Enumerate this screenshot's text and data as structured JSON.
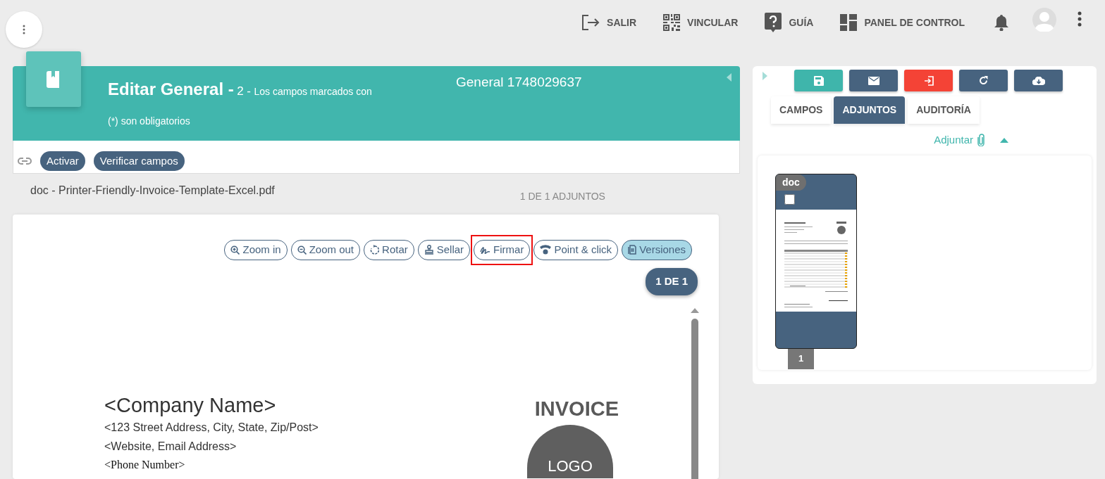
{
  "top_menu": [
    {
      "kind": "logout",
      "label": "SALIR"
    },
    {
      "kind": "qr",
      "label": "VINCULAR"
    },
    {
      "kind": "help",
      "label": "GUÍA"
    },
    {
      "kind": "dashboard",
      "label": "PANEL DE CONTROL"
    }
  ],
  "header": {
    "title": "Editar General -",
    "count": "2 -",
    "note": "Los campos marcados con (*) son obligatorios",
    "record": "General 1748029637"
  },
  "actions": [
    "Activar",
    "Verificar campos"
  ],
  "attachment": {
    "filename": "doc - Printer-Friendly-Invoice-Template-Excel.pdf",
    "counter": "1 DE 1 ADJUNTOS"
  },
  "viewer_tools": [
    {
      "kind": "zoom-in",
      "label": "Zoom in",
      "selected": false,
      "highlighted": false
    },
    {
      "kind": "zoom-out",
      "label": "Zoom out",
      "selected": false,
      "highlighted": false
    },
    {
      "kind": "rotate",
      "label": "Rotar",
      "selected": false,
      "highlighted": false
    },
    {
      "kind": "stamp",
      "label": "Sellar",
      "selected": false,
      "highlighted": false
    },
    {
      "kind": "sign",
      "label": "Firmar",
      "selected": false,
      "highlighted": true
    },
    {
      "kind": "pointer",
      "label": "Point & click",
      "selected": false,
      "highlighted": false
    },
    {
      "kind": "versions",
      "label": "Versiones",
      "selected": true,
      "highlighted": false
    }
  ],
  "page_indicator": "1 DE 1",
  "document": {
    "company": "<Company Name>",
    "address": "<123 Street Address, City, State, Zip/Post>",
    "web": "<Website, Email Address>",
    "phone": "<Phone Number>",
    "title": "INVOICE",
    "logo": "LOGO"
  },
  "right_buttons": [
    {
      "kind": "save",
      "color": "#3fb5ab"
    },
    {
      "kind": "mail",
      "color": "#47637f"
    },
    {
      "kind": "enter",
      "color": "#f44336"
    },
    {
      "kind": "refresh",
      "color": "#47637f"
    },
    {
      "kind": "download",
      "color": "#47637f"
    }
  ],
  "tabs": [
    {
      "label": "CAMPOS",
      "selected": false
    },
    {
      "label": "ADJUNTOS",
      "selected": true
    },
    {
      "label": "AUDITORÍA",
      "selected": false
    }
  ],
  "attach_link": "Adjuntar",
  "thumbnails": [
    {
      "label": "doc",
      "checked": false,
      "page": "1"
    }
  ]
}
